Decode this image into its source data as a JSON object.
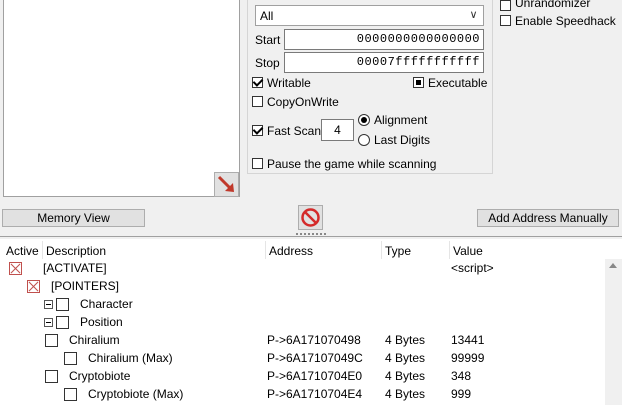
{
  "top_right": {
    "unrandomizer": "Unrandomizer",
    "enable_speedhack": "Enable Speedhack"
  },
  "scan": {
    "region_value": "All",
    "start_label": "Start",
    "start_value": "0000000000000000",
    "stop_label": "Stop",
    "stop_value": "00007fffffffffff",
    "writable": "Writable",
    "executable": "Executable",
    "copy_on_write": "CopyOnWrite",
    "fast_scan": "Fast Scan",
    "fast_scan_value": "4",
    "alignment": "Alignment",
    "last_digits": "Last Digits",
    "pause_game": "Pause the game while scanning"
  },
  "buttons": {
    "memory_view": "Memory View",
    "add_address": "Add Address Manually"
  },
  "table": {
    "headers": [
      "Active",
      "Description",
      "Address",
      "Type",
      "Value"
    ],
    "rows": [
      {
        "description": "[ACTIVATE]",
        "address": "",
        "type": "",
        "value": "<script>"
      },
      {
        "description": "[POINTERS]",
        "address": "",
        "type": "",
        "value": ""
      },
      {
        "description": "Character",
        "address": "",
        "type": "",
        "value": ""
      },
      {
        "description": "Position",
        "address": "",
        "type": "",
        "value": ""
      },
      {
        "description": "Chiralium",
        "address": "P->6A171070498",
        "type": "4 Bytes",
        "value": "13441"
      },
      {
        "description": "Chiralium (Max)",
        "address": "P->6A17107049C",
        "type": "4 Bytes",
        "value": "99999"
      },
      {
        "description": "Cryptobiote",
        "address": "P->6A1710704E0",
        "type": "4 Bytes",
        "value": "348"
      },
      {
        "description": "Cryptobiote (Max)",
        "address": "P->6A1710704E4",
        "type": "4 Bytes",
        "value": "999"
      }
    ]
  },
  "colors": {
    "active_x": "#c0504d",
    "arrow_red": "#c0392b",
    "stop_red": "#d42a2a"
  }
}
